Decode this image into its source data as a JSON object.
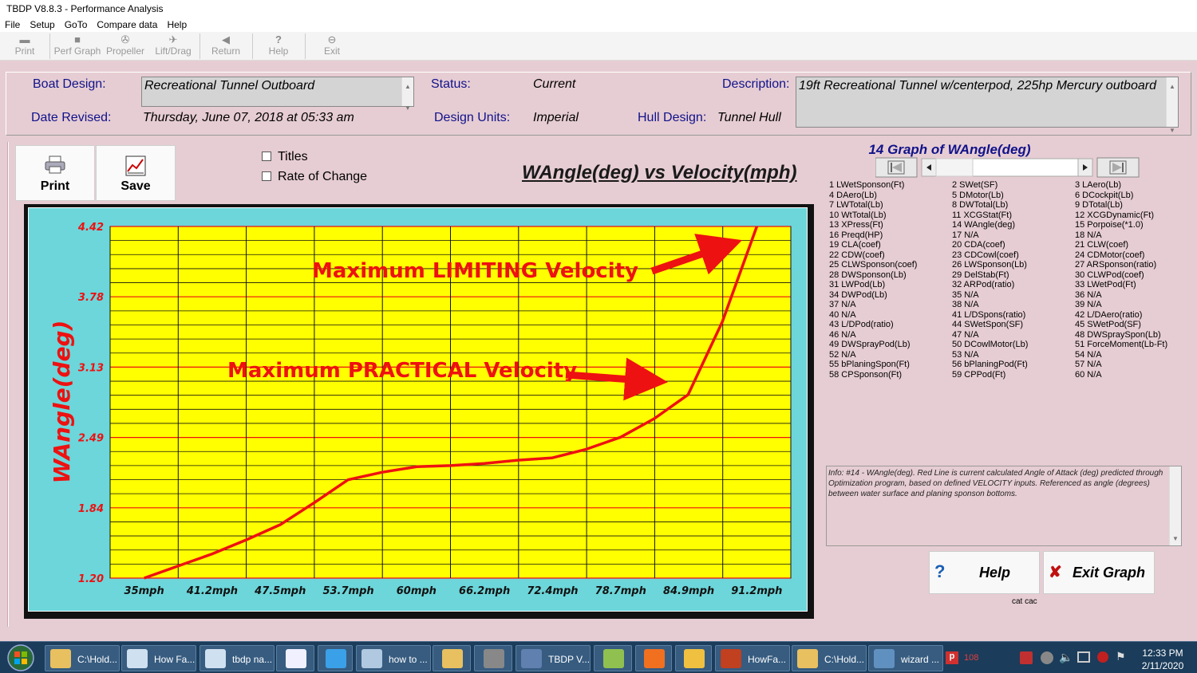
{
  "window": {
    "title": "TBDP V8.8.3 - Performance Analysis"
  },
  "menu": [
    "File",
    "Setup",
    "GoTo",
    "Compare data",
    "Help"
  ],
  "toolbar": [
    {
      "label": "Print",
      "icon": "printer-icon"
    },
    {
      "label": "Perf Graph",
      "icon": "graph-icon"
    },
    {
      "label": "Propeller",
      "icon": "propeller-icon"
    },
    {
      "label": "Lift/Drag",
      "icon": "lift-drag-icon"
    },
    {
      "label": "Return",
      "icon": "return-arrow-icon"
    },
    {
      "label": "Help",
      "icon": "question-icon"
    },
    {
      "label": "Exit",
      "icon": "exit-icon"
    }
  ],
  "info": {
    "boat_design_label": "Boat Design:",
    "boat_design": "Recreational Tunnel Outboard",
    "status_label": "Status:",
    "status": "Current",
    "description_label": "Description:",
    "description": "19ft Recreational Tunnel w/centerpod, 225hp Mercury outboard",
    "date_revised_label": "Date Revised:",
    "date_revised": "Thursday, June 07, 2018 at 05:33 am",
    "design_units_label": "Design Units:",
    "design_units": "Imperial",
    "hull_design_label": "Hull Design:",
    "hull_design": "Tunnel Hull"
  },
  "graph_buttons": {
    "print": "Print",
    "save": "Save"
  },
  "options": {
    "titles": "Titles",
    "rate_of_change": "Rate of Change"
  },
  "graph_title": "WAngle(deg) vs Velocity(mph)",
  "side_title": "14 Graph of WAngle(deg)",
  "variables": [
    "1 LWetSponson(Ft)",
    "2 SWet(SF)",
    "3 LAero(Lb)",
    "4 DAero(Lb)",
    "5 DMotor(Lb)",
    "6 DCockpit(Lb)",
    "7 LWTotal(Lb)",
    "8 DWTotal(Lb)",
    "9 DTotal(Lb)",
    "10 WtTotal(Lb)",
    "11 XCGStat(Ft)",
    "12 XCGDynamic(Ft)",
    "13 XPress(Ft)",
    "14 WAngle(deg)",
    "15 Porpoise(*1.0)",
    "16 Preqd(HP)",
    "17 N/A",
    "18 N/A",
    "19 CLA(coef)",
    "20 CDA(coef)",
    "21 CLW(coef)",
    "22 CDW(coef)",
    "23 CDCowl(coef)",
    "24 CDMotor(coef)",
    "25 CLWSponson(coef)",
    "26 LWSponson(Lb)",
    "27 ARSponson(ratio)",
    "28 DWSponson(Lb)",
    "29 DelStab(Ft)",
    "30 CLWPod(coef)",
    "31 LWPod(Lb)",
    "32 ARPod(ratio)",
    "33 LWetPod(Ft)",
    "34 DWPod(Lb)",
    "35 N/A",
    "36 N/A",
    "37 N/A",
    "38 N/A",
    "39 N/A",
    "40 N/A",
    "41 L/DSpons(ratio)",
    "42 L/DAero(ratio)",
    "43 L/DPod(ratio)",
    "44 SWetSpon(SF)",
    "45 SWetPod(SF)",
    "46 N/A",
    "47 N/A",
    "48 DWSpraySpon(Lb)",
    "49 DWSprayPod(Lb)",
    "50 DCowlMotor(Lb)",
    "51 ForceMoment(Lb-Ft)",
    "52 N/A",
    "53 N/A",
    "54 N/A",
    "55 bPlaningSpon(Ft)",
    "56 bPlaningPod(Ft)",
    "57 N/A",
    "58 CPSponson(Ft)",
    "59 CPPod(Ft)",
    "60 N/A"
  ],
  "info_text": "Info: #14 - WAngle(deg). Red Line is current calculated Angle of Attack (deg) predicted through Optimization program, based on defined VELOCITY inputs. Referenced as angle (degrees) between water surface and planing sponson bottoms.",
  "action_buttons": {
    "help": "Help",
    "exit": "Exit Graph",
    "caption": "cat cac"
  },
  "chart_data": {
    "type": "line",
    "title": "WAngle(deg) vs Velocity(mph)",
    "xlabel": "",
    "ylabel": "WAngle(deg)",
    "categories": [
      "35mph",
      "41.2mph",
      "47.5mph",
      "53.7mph",
      "60mph",
      "66.2mph",
      "72.4mph",
      "78.7mph",
      "84.9mph",
      "91.2mph"
    ],
    "y_ticks": [
      "4.42",
      "3.78",
      "3.13",
      "2.49",
      "1.84",
      "1.20"
    ],
    "ylim": [
      1.2,
      4.42
    ],
    "grid": true,
    "colors": {
      "plot_bg": "#ffff00",
      "frame_bg": "#6cd6da",
      "line": "#ee1111",
      "grid_major": "#ee1111",
      "grid_minor": "#111111"
    },
    "series": [
      {
        "x": [
          35,
          38.1,
          41.2,
          44.35,
          47.5,
          50.6,
          53.7,
          56.85,
          60,
          63.1,
          66.2,
          69.3,
          72.4,
          75.55,
          78.7,
          81.8,
          84.9,
          88.05,
          91.2
        ],
        "y": [
          1.2,
          1.31,
          1.42,
          1.55,
          1.69,
          1.89,
          2.1,
          2.17,
          2.22,
          2.23,
          2.25,
          2.28,
          2.3,
          2.38,
          2.49,
          2.66,
          2.88,
          3.55,
          4.42
        ]
      }
    ],
    "annotations": [
      "Maximum LIMITING Velocity",
      "Maximum PRACTICAL Velocity"
    ]
  },
  "taskbar": {
    "items": [
      {
        "label": "C:\\Hold...",
        "icon": "folder-icon",
        "color": "#e8c060"
      },
      {
        "label": "How Fa...",
        "icon": "document-icon",
        "color": "#cfe0f0"
      },
      {
        "label": "tbdp na...",
        "icon": "document-icon",
        "color": "#cfe0f0"
      },
      {
        "label": "",
        "icon": "text-editor-icon",
        "color": "#f0f0ff"
      },
      {
        "label": "",
        "icon": "internet-explorer-icon",
        "color": "#3aa0e8"
      },
      {
        "label": "how to ...",
        "icon": "notepad-icon",
        "color": "#b0c8e0"
      },
      {
        "label": "",
        "icon": "folder-icon",
        "color": "#e8c060"
      },
      {
        "label": "",
        "icon": "camera-icon",
        "color": "#888888"
      },
      {
        "label": "TBDP V...",
        "icon": "boat-app-icon",
        "color": "#6080b0"
      },
      {
        "label": "",
        "icon": "chart-app-icon",
        "color": "#90c050"
      },
      {
        "label": "",
        "icon": "firefox-icon",
        "color": "#f07020"
      },
      {
        "label": "",
        "icon": "mail-icon",
        "color": "#f0c040"
      },
      {
        "label": "HowFa...",
        "icon": "book-icon",
        "color": "#c04020"
      },
      {
        "label": "C:\\Hold...",
        "icon": "folder-icon",
        "color": "#e8c060"
      },
      {
        "label": "wizard ...",
        "icon": "image-icon",
        "color": "#6090c0"
      }
    ],
    "tray_count": "108",
    "time": "12:33 PM",
    "date": "2/11/2020"
  }
}
